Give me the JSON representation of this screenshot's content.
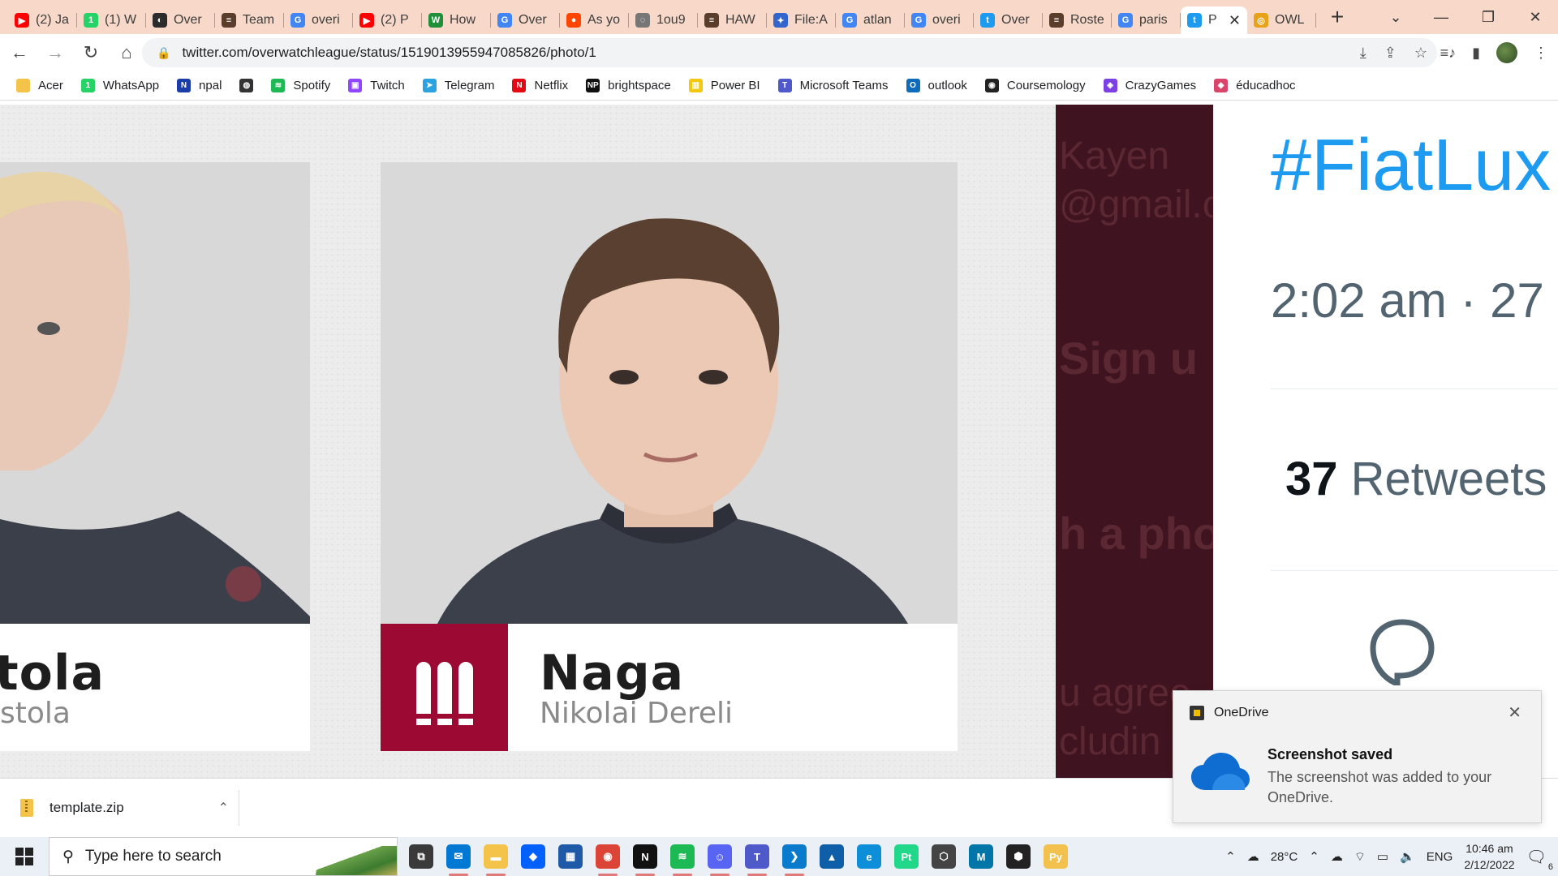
{
  "browser": {
    "tabs": [
      {
        "title": "(2) Ja",
        "color": "#ff0000",
        "glyph": "▶"
      },
      {
        "title": "(1) W",
        "color": "#25d366",
        "glyph": "1"
      },
      {
        "title": "Over",
        "color": "#2c2c2c",
        "glyph": "◐"
      },
      {
        "title": "Team",
        "color": "#5a3d2b",
        "glyph": "≡"
      },
      {
        "title": "overi",
        "color": "#4285f4",
        "glyph": "G"
      },
      {
        "title": "(2) P",
        "color": "#ff0000",
        "glyph": "▶"
      },
      {
        "title": "How",
        "color": "#1f8f3a",
        "glyph": "W"
      },
      {
        "title": "Over",
        "color": "#4285f4",
        "glyph": "G"
      },
      {
        "title": "As yo",
        "color": "#ff4500",
        "glyph": "●"
      },
      {
        "title": "1ou9",
        "color": "#777777",
        "glyph": "◌"
      },
      {
        "title": "HAW",
        "color": "#5a3d2b",
        "glyph": "≡"
      },
      {
        "title": "File:A",
        "color": "#36c",
        "glyph": "✦"
      },
      {
        "title": "atlan",
        "color": "#4285f4",
        "glyph": "G"
      },
      {
        "title": "overi",
        "color": "#4285f4",
        "glyph": "G"
      },
      {
        "title": "Over",
        "color": "#1d9bf0",
        "glyph": "t"
      },
      {
        "title": "Roste",
        "color": "#5a3d2b",
        "glyph": "≡"
      },
      {
        "title": "paris",
        "color": "#4285f4",
        "glyph": "G"
      }
    ],
    "active_tab": {
      "title": "P",
      "color": "#1d9bf0",
      "glyph": "t",
      "close": "✕"
    },
    "last_tab": {
      "title": "OWL",
      "color": "#e8a21a",
      "glyph": "◎"
    },
    "new_tab": "+",
    "window_controls": {
      "dropdown": "⌄",
      "minimize": "—",
      "restore": "❐",
      "close": "✕"
    },
    "nav": {
      "back": "←",
      "forward": "→",
      "reload": "↻",
      "home": "⌂"
    },
    "url": "twitter.com/overwatchleague/status/1519013955947085826/photo/1",
    "omnibox_icons": {
      "install": "⤓",
      "share": "⇪",
      "star": "☆"
    },
    "toolbar_icons": {
      "media": "≡♪",
      "sidepanel": "▮"
    }
  },
  "bookmarks": [
    {
      "label": "Acer",
      "color": "#f3c34a",
      "glyph": ""
    },
    {
      "label": "WhatsApp",
      "color": "#25d366",
      "glyph": "1"
    },
    {
      "label": "npal",
      "color": "#1a3da8",
      "glyph": "N"
    },
    {
      "label": "",
      "color": "#333333",
      "glyph": "◍"
    },
    {
      "label": "Spotify",
      "color": "#1db954",
      "glyph": "≋"
    },
    {
      "label": "Twitch",
      "color": "#9146ff",
      "glyph": "▣"
    },
    {
      "label": "Telegram",
      "color": "#2aa3e0",
      "glyph": "➤"
    },
    {
      "label": "Netflix",
      "color": "#e50914",
      "glyph": "N"
    },
    {
      "label": "brightspace",
      "color": "#111111",
      "glyph": "NP"
    },
    {
      "label": "Power BI",
      "color": "#f2c811",
      "glyph": "▥"
    },
    {
      "label": "Microsoft Teams",
      "color": "#5059c9",
      "glyph": "T"
    },
    {
      "label": "outlook",
      "color": "#0f6cbd",
      "glyph": "O"
    },
    {
      "label": "Coursemology",
      "color": "#222222",
      "glyph": "◉"
    },
    {
      "label": "CrazyGames",
      "color": "#7b3fe4",
      "glyph": "◈"
    },
    {
      "label": "éducadhoc",
      "color": "#d9456b",
      "glyph": "◆"
    }
  ],
  "photo": {
    "cards": [
      {
        "gamertag": "tola",
        "real_name": "stola"
      },
      {
        "gamertag": "Naga",
        "real_name": "Nikolai Dereli"
      }
    ],
    "brand_color": "#9c0a33",
    "overlay_text": [
      "Kayen",
      "@gmail.co",
      "Sign u",
      "h a pho",
      "u agree",
      "cludin"
    ]
  },
  "tweet": {
    "hashtag": "#FiatLux",
    "time": "2:02 am · 27",
    "retweet_count": "37",
    "retweet_label": "Retweets"
  },
  "download": {
    "filename": "template.zip",
    "chevron": "⌃"
  },
  "toast": {
    "app": "OneDrive",
    "title": "Screenshot saved",
    "body": "The screenshot was added to your OneDrive.",
    "close": "✕"
  },
  "taskbar": {
    "search_placeholder": "Type here to search",
    "apps": [
      {
        "name": "task-view",
        "color": "#3a3a3a",
        "glyph": "⧉"
      },
      {
        "name": "mail",
        "color": "#0078d4",
        "glyph": "✉"
      },
      {
        "name": "file-explorer",
        "color": "#f3c34a",
        "glyph": "▬"
      },
      {
        "name": "dropbox",
        "color": "#0061fe",
        "glyph": "◆"
      },
      {
        "name": "store",
        "color": "#1e5aa8",
        "glyph": "▦"
      },
      {
        "name": "chrome",
        "color": "#db4437",
        "glyph": "◉"
      },
      {
        "name": "netflix",
        "color": "#111111",
        "glyph": "N"
      },
      {
        "name": "spotify",
        "color": "#1db954",
        "glyph": "≋"
      },
      {
        "name": "discord",
        "color": "#5865f2",
        "glyph": "☺"
      },
      {
        "name": "teams",
        "color": "#5059c9",
        "glyph": "T"
      },
      {
        "name": "vscode",
        "color": "#0a7acc",
        "glyph": "❯"
      },
      {
        "name": "photos",
        "color": "#0f5fa8",
        "glyph": "▲"
      },
      {
        "name": "edge",
        "color": "#0c8fd8",
        "glyph": "e"
      },
      {
        "name": "pycharm",
        "color": "#21d789",
        "glyph": "Pt"
      },
      {
        "name": "unity-hub",
        "color": "#444444",
        "glyph": "⬡"
      },
      {
        "name": "matlab",
        "color": "#0076a8",
        "glyph": "M"
      },
      {
        "name": "unity",
        "color": "#222222",
        "glyph": "⬢"
      },
      {
        "name": "python",
        "color": "#f2c14e",
        "glyph": "Py"
      }
    ],
    "weather": "28°C",
    "language": "ENG",
    "time": "10:46 am",
    "date": "2/12/2022",
    "notification_count": "6"
  }
}
